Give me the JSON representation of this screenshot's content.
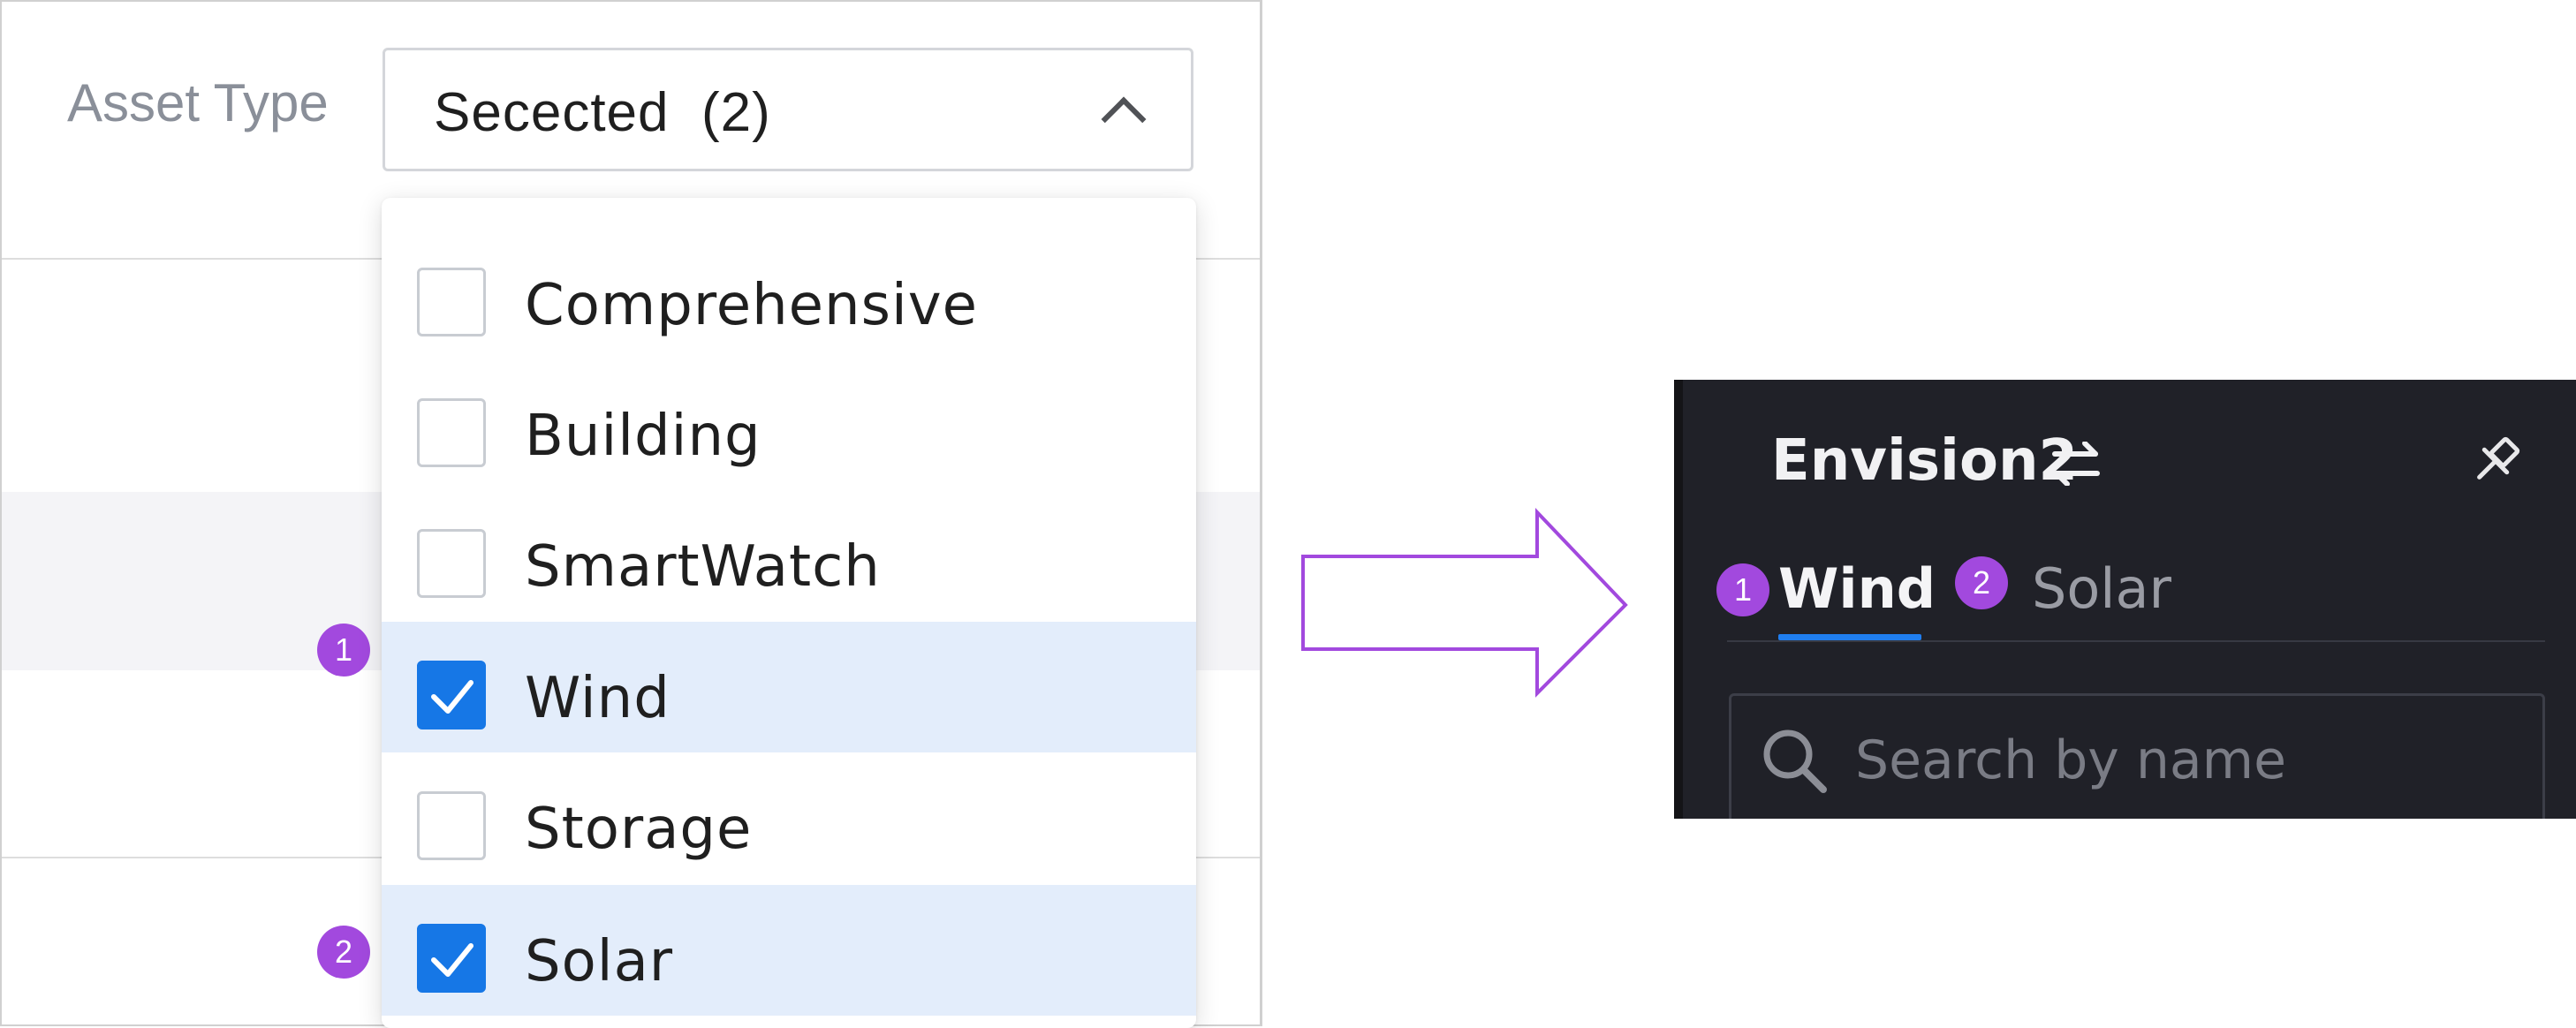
{
  "asset_filter": {
    "label": "Asset Type",
    "selected_text": "Secected  (2)",
    "options": [
      {
        "label": "Comprehensive",
        "checked": false
      },
      {
        "label": "Building",
        "checked": false
      },
      {
        "label": "SmartWatch",
        "checked": false
      },
      {
        "label": "Wind",
        "checked": true,
        "badge": "1"
      },
      {
        "label": "Storage",
        "checked": false
      },
      {
        "label": "Solar",
        "checked": true,
        "badge": "2"
      }
    ]
  },
  "result_panel": {
    "project_name": "Envision2",
    "tabs": [
      {
        "label": "Wind",
        "badge": "1",
        "active": true
      },
      {
        "label": "Solar",
        "badge": "2",
        "active": false
      }
    ],
    "search_placeholder": "Search by name"
  },
  "colors": {
    "accent_blue": "#1677e6",
    "badge_purple": "#a249de",
    "arrow_purple": "#a249de",
    "dark_bg": "#202128",
    "checked_row_bg": "#e3edfb"
  }
}
